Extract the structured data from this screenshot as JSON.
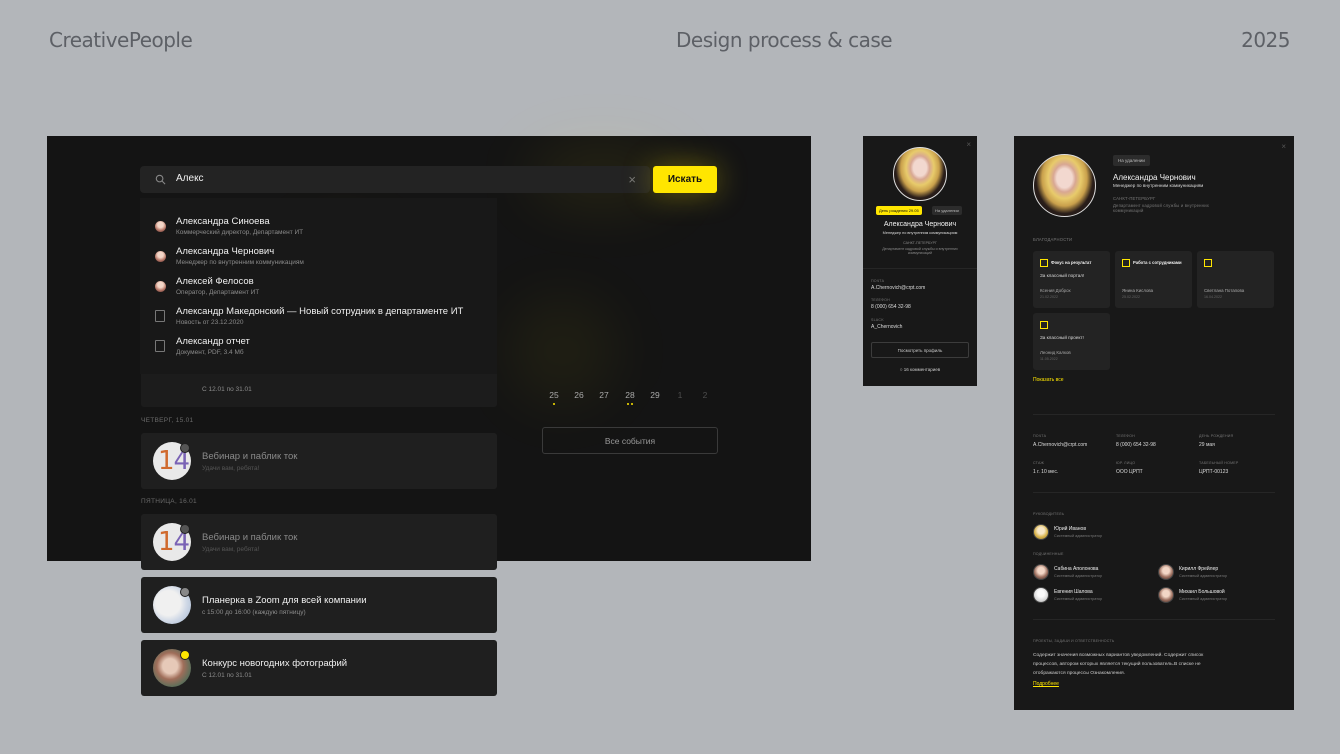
{
  "header": {
    "brand": "CreativePeople",
    "title": "Design process & case",
    "year": "2025"
  },
  "search": {
    "query": "Алекс",
    "button": "Искать",
    "results": [
      {
        "title": "Александра Синоева",
        "subtitle": "Коммерческий директор, Департамент ИТ",
        "icon": "avatar"
      },
      {
        "title": "Александра Чернович",
        "subtitle": "Менеджер по внутренним коммуникациям",
        "icon": "avatar"
      },
      {
        "title": "Алексей Фелосов",
        "subtitle": "Оператор, Департамент ИТ",
        "icon": "avatar"
      },
      {
        "title": "Александр Македонский — Новый сотрудник в департаменте ИТ",
        "subtitle": "Новость от 23.12.2020",
        "icon": "news-icon"
      },
      {
        "title": "Александр отчет",
        "subtitle": "Документ, PDF, 3.4 Мб",
        "icon": "document-icon"
      }
    ]
  },
  "events": {
    "hidden_date": "С 12.01 по 31.01",
    "section_thu": "ЧЕТВЕРГ, 15.01",
    "section_fri": "ПЯТНИЦА, 16.01",
    "cards": [
      {
        "title": "Вебинар и паблик ток",
        "subtitle": "Удачи вам, ребята!",
        "day": "14"
      },
      {
        "title": "Вебинар и паблик ток",
        "subtitle": "Удачи вам, ребята!",
        "day": "14"
      },
      {
        "title": "Планерка в Zoom для всей компании",
        "subtitle": "с 15:00 до 16:00 (каждую пятницу)"
      },
      {
        "title": "Конкурс новогодних фотографий",
        "subtitle": "С 12.01 по 31.01"
      }
    ],
    "calendar_days": [
      "25",
      "26",
      "27",
      "28",
      "29",
      "1",
      "2"
    ],
    "all_events": "Все события"
  },
  "profile_small": {
    "close": "×",
    "birthday_badge": "День рождения 29.05",
    "status_badge": "На удалении",
    "name": "Александра Чернович",
    "role": "Менеджер по внутренним коммуникациям",
    "city": "САНКТ-ПЕТЕРБУРГ",
    "department": "Департамент кадровой службы и внутренних коммуникаций",
    "email_label": "ПОЧТА",
    "email": "A.Chernovich@crpt.com",
    "phone_label": "ТЕЛЕФОН",
    "phone": "8 (000) 654 32-98",
    "slack_label": "SLACK",
    "slack": "A_Chernovich",
    "view_profile": "Посмотреть профиль",
    "comments": "16 комментариев"
  },
  "profile_large": {
    "close": "×",
    "status_badge": "На удалении",
    "name": "Александра Чернович",
    "role": "Менеджер по внутренним коммуникациям",
    "city": "САНКТ-ПЕТЕРБУРГ",
    "department": "Департамент кадровой службы и внутренних коммуникаций",
    "thanks_label": "БЛАГОДАРНОСТИ",
    "thanks": [
      {
        "tag": "Фокус на результат",
        "msg": "За классный портал!",
        "who": "Ксения Доброх",
        "date": "21.02.2022"
      },
      {
        "tag": "Работа с сотрудниками",
        "msg": "",
        "who": "Янина Кислова",
        "date": "25.02.2022"
      },
      {
        "tag": "",
        "msg": "",
        "who": "Светлана Потапова",
        "date": "16.04.2022"
      },
      {
        "tag": "",
        "msg": "За классный проект!",
        "who": "Леонид Калков",
        "date": "11.05.2022"
      }
    ],
    "show_all": "Показать все",
    "info": [
      {
        "label": "ПОЧТА",
        "value": "A.Chernovich@crpt.com"
      },
      {
        "label": "ТЕЛЕФОН",
        "value": "8 (000) 654 32-98"
      },
      {
        "label": "ДЕНЬ РОЖДЕНИЯ",
        "value": "29 мая"
      },
      {
        "label": "СТАЖ",
        "value": "1 г. 10 мес."
      },
      {
        "label": "ЮР. ЛИЦО",
        "value": "ООО ЦРПТ"
      },
      {
        "label": "ТАБЕЛЬНЫЙ НОМЕР",
        "value": "ЦРПТ-00123"
      }
    ],
    "manager_label": "РУКОВОДИТЕЛЬ",
    "manager": {
      "name": "Юрий Иванов",
      "role": "Системный администратор"
    },
    "subs_label": "ПОДЧИНЕННЫЕ",
    "subordinates": [
      {
        "name": "Сабина Аполонова",
        "role": "Системный администратор"
      },
      {
        "name": "Кирилл Фрейлер",
        "role": "Системный администратор"
      },
      {
        "name": "Евгения Шалова",
        "role": "Системный администратор"
      },
      {
        "name": "Михаил Большовой",
        "role": "Системный администратор"
      }
    ],
    "projects_label": "ПРОЕКТЫ, ЗАДАЧИ И ОТВЕТСТВЕННОСТЬ",
    "projects_line1": "Содержит значения возможных вариантов уведомлений. Содержит список",
    "projects_line2": "процессов, автором которых является текущий пользователь.В списке не",
    "projects_line3": "отображаются процессы Ознакомления.",
    "more": "Подробнее"
  }
}
